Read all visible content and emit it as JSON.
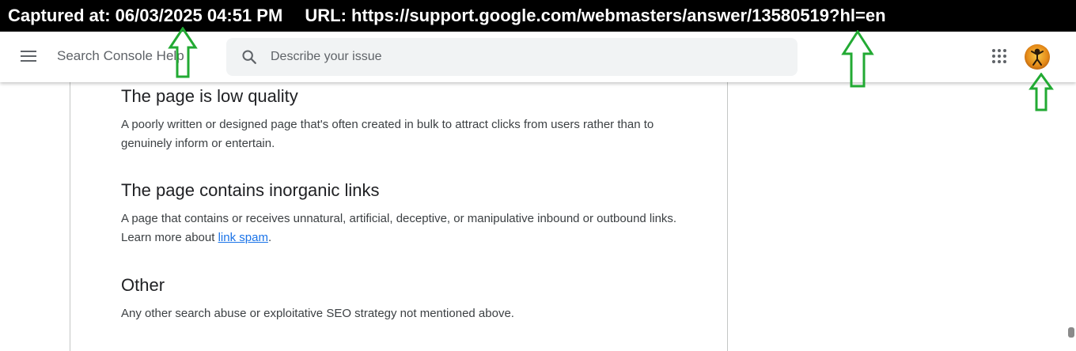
{
  "capture": {
    "captured_label": "Captured at: 06/03/2025 04:51 PM",
    "url_label": "URL: https://support.google.com/webmasters/answer/13580519?hl=en"
  },
  "header": {
    "brand": "Search Console Help",
    "search_placeholder": "Describe your issue",
    "menu_icon": "hamburger-menu-icon",
    "apps_icon": "google-apps-grid-icon",
    "avatar_icon": "user-avatar"
  },
  "sections": [
    {
      "heading": "The page is low quality",
      "text": "A poorly written or designed page that's often created in bulk to attract clicks from users rather than to genuinely inform or entertain."
    },
    {
      "heading": "The page contains inorganic links",
      "text_before": "A page that contains or receives unnatural, artificial, deceptive, or manipulative inbound or outbound links. Learn more about ",
      "link": "link spam",
      "text_after": "."
    },
    {
      "heading": "Other",
      "text": "Any other search abuse or exploitative SEO strategy not mentioned above."
    }
  ],
  "colors": {
    "link": "#1a73e8",
    "annotation_arrow": "#22aa33",
    "capture_bar_bg": "#000000"
  }
}
